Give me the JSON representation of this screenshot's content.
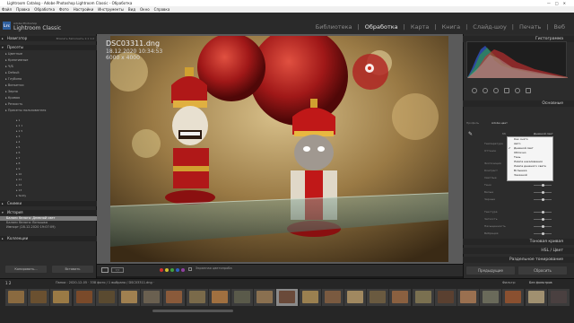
{
  "window": {
    "title": "Lightroom Catalog - Adobe Photoshop Lightroom Classic - Обработка"
  },
  "menu": [
    "Файл",
    "Правка",
    "Обработка",
    "Фото",
    "Настройки",
    "Инструменты",
    "Вид",
    "Окно",
    "Справка"
  ],
  "identity": {
    "brand_top": "Adobe Photoshop",
    "brand": "Lightroom Classic",
    "logo": "Lrc"
  },
  "modules": [
    "Библиотека",
    "Обработка",
    "Карта",
    "Книга",
    "Слайд-шоу",
    "Печать",
    "Веб"
  ],
  "left_panel": {
    "navigator": "Навигатор",
    "navigator_tabs": "Вписать  Заполнить  1:1  1:2",
    "presets": "Пресеты",
    "preset_groups": [
      "Цветные",
      "Креативные",
      "Ч/Б",
      "Default",
      "Глубина",
      "Виньетки",
      "Зерно",
      "Кривая",
      "Резкость",
      "Пресеты пользователя"
    ],
    "user_presets": [
      "1",
      "1 1",
      "1 5",
      "3",
      "4",
      "5",
      "6",
      "7",
      "8",
      "9",
      "10",
      "11",
      "12",
      "13",
      "Teddy"
    ],
    "snapshots": "Снимки",
    "history": "История",
    "history_items": [
      "Баланс белого: Дневной свет",
      "Баланс белого: Вспышка",
      "Импорт (28.12.2020 19:07:09)"
    ],
    "collections": "Коллекции",
    "copy_btn": "Копировать...",
    "paste_btn": "Вставить"
  },
  "photo": {
    "filename": "DSC03311.dng",
    "info1": "18.12.2020 10:34:53",
    "info2": "6000 x 4000"
  },
  "toolbar": {
    "softproof": "Экранная цветопроба"
  },
  "right_panel": {
    "histogram": "Гистограмма",
    "basic": "Основные",
    "profile_label": "Профиль",
    "profile_value": "Adobe цвет",
    "wb_label": "ББ",
    "wb_value": "Дневной свет",
    "sliders": [
      "Температура",
      "Оттенок",
      "Экспозиция",
      "Контраст",
      "Светлые",
      "Тени",
      "Белые",
      "Черные",
      "Текстура",
      "Четкость",
      "Насыщенность",
      "Вибрация"
    ],
    "wb_options": [
      "Как снято",
      "Авто",
      "Дневной свет",
      "Облачно",
      "Тень",
      "Лампа накаливания",
      "Лампа дневного света",
      "Вспышка",
      "Заказной"
    ],
    "wb_selected": "Дневной свет",
    "tone_curve": "Тоновая кривая",
    "hsl": "HSL / Цвет",
    "split": "Раздельное тонирование",
    "prev_btn": "Предыдущие",
    "reset_btn": "Сбросить"
  },
  "filmstrip": {
    "pages": "1  2",
    "source": "Папка : 2020-12-05 · 338 фото / 1 выбрано / DSC03311.dng ·",
    "filter": "Фильтр:",
    "filter_value": "Без фильтров"
  },
  "colors": {
    "accent": "#e8e8e8",
    "panel": "#2c2c2c",
    "logo": "#2e5f9e"
  }
}
